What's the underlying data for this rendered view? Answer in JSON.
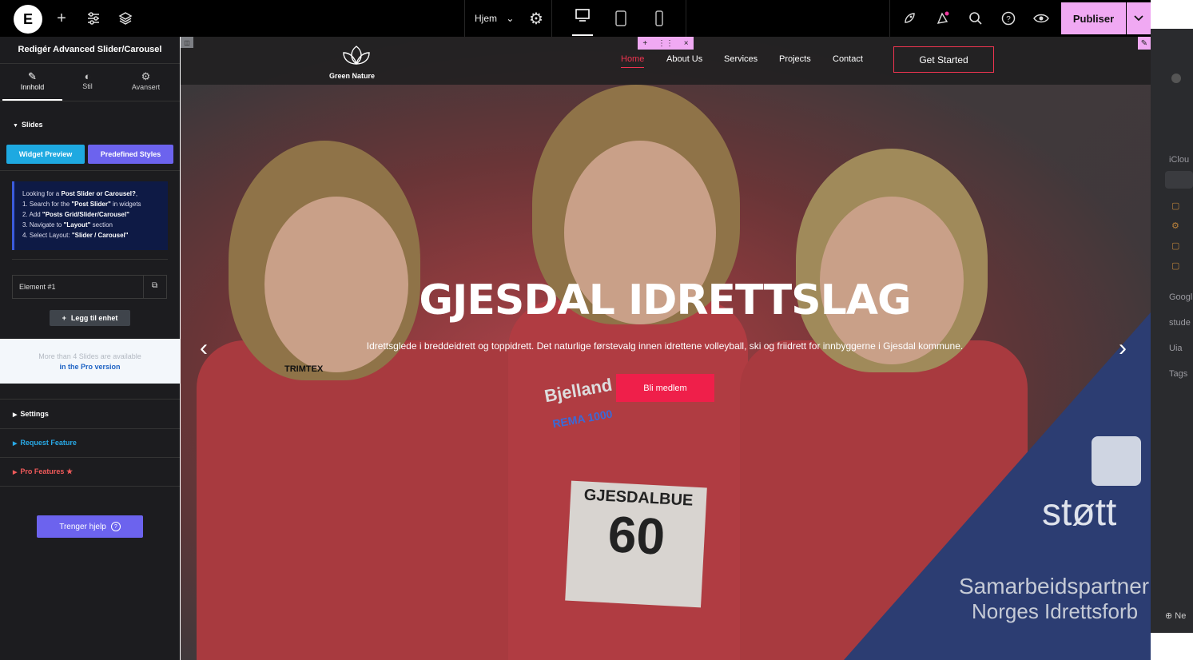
{
  "topbar": {
    "page_select": "Hjem",
    "publish_label": "Publiser"
  },
  "panel": {
    "title": "Redigér Advanced Slider/Carousel",
    "tabs": [
      {
        "label": "Innhold",
        "icon": "pencil-icon"
      },
      {
        "label": "Stil",
        "icon": "contrast-icon"
      },
      {
        "label": "Avansert",
        "icon": "gear-icon"
      }
    ],
    "slides_heading": "Slides",
    "widget_preview": "Widget Preview",
    "predefined_styles": "Predefined Styles",
    "info": {
      "line1_pre": "Looking for a ",
      "line1_bold": "Post Slider or Carousel?",
      "line1_post": ",",
      "line2_pre": "1. Search for the ",
      "line2_bold": "\"Post Slider\"",
      "line2_post": " in widgets",
      "line3_pre": "2. Add ",
      "line3_bold": "\"Posts Grid/Slider/Carousel\"",
      "line4_pre": "3. Navigate to ",
      "line4_bold": "\"Layout\"",
      "line4_post": " section",
      "line5_pre": "4. Select Layout: ",
      "line5_bold": "\"Slider / Carousel\""
    },
    "element_label": "Element #1",
    "add_item": "Legg til enhet",
    "pro_line1": "More than 4 Slides are available",
    "pro_line2_pre": "in the ",
    "pro_line2_link": "Pro version",
    "settings": "Settings",
    "request_feature": "Request Feature",
    "pro_features": "Pro Features",
    "help": "Trenger hjelp"
  },
  "site": {
    "brand": "Green Nature",
    "nav": [
      "Home",
      "About Us",
      "Services",
      "Projects",
      "Contact"
    ],
    "cta": "Get Started",
    "hero_title": "GJESDAL IDRETTSLAG",
    "hero_sub": "Idrettsglede i breddeidrett og toppidrett. Det naturlige førstevalg innen idrettene volleyball, ski og friidrett for innbyggerne i Gjesdal kommune.",
    "hero_button": "Bli medlem",
    "partner_word": "støtt",
    "partner_line1": "Samarbeidspartner",
    "partner_line2": "Norges Idrettsforb",
    "photo_texts": {
      "bib_number": "60",
      "bib_name": "GJESDALBUE",
      "sponsor": "Bjelland",
      "sponsor2": "REMA 1000",
      "sponsor3": "TRIMTEX"
    }
  },
  "right_strip": {
    "items": [
      "iClou",
      "Googl",
      "stude",
      "Uia",
      "Tags",
      "Ne"
    ]
  },
  "colors": {
    "accent_pink": "#f0a9f3",
    "brand_red": "#ef3450",
    "panel_bg": "#1c1c1f",
    "widget_preview_bg": "#1ea9e1",
    "predefined_bg": "#6c63ee",
    "partner_blue": "#2c3d72"
  }
}
